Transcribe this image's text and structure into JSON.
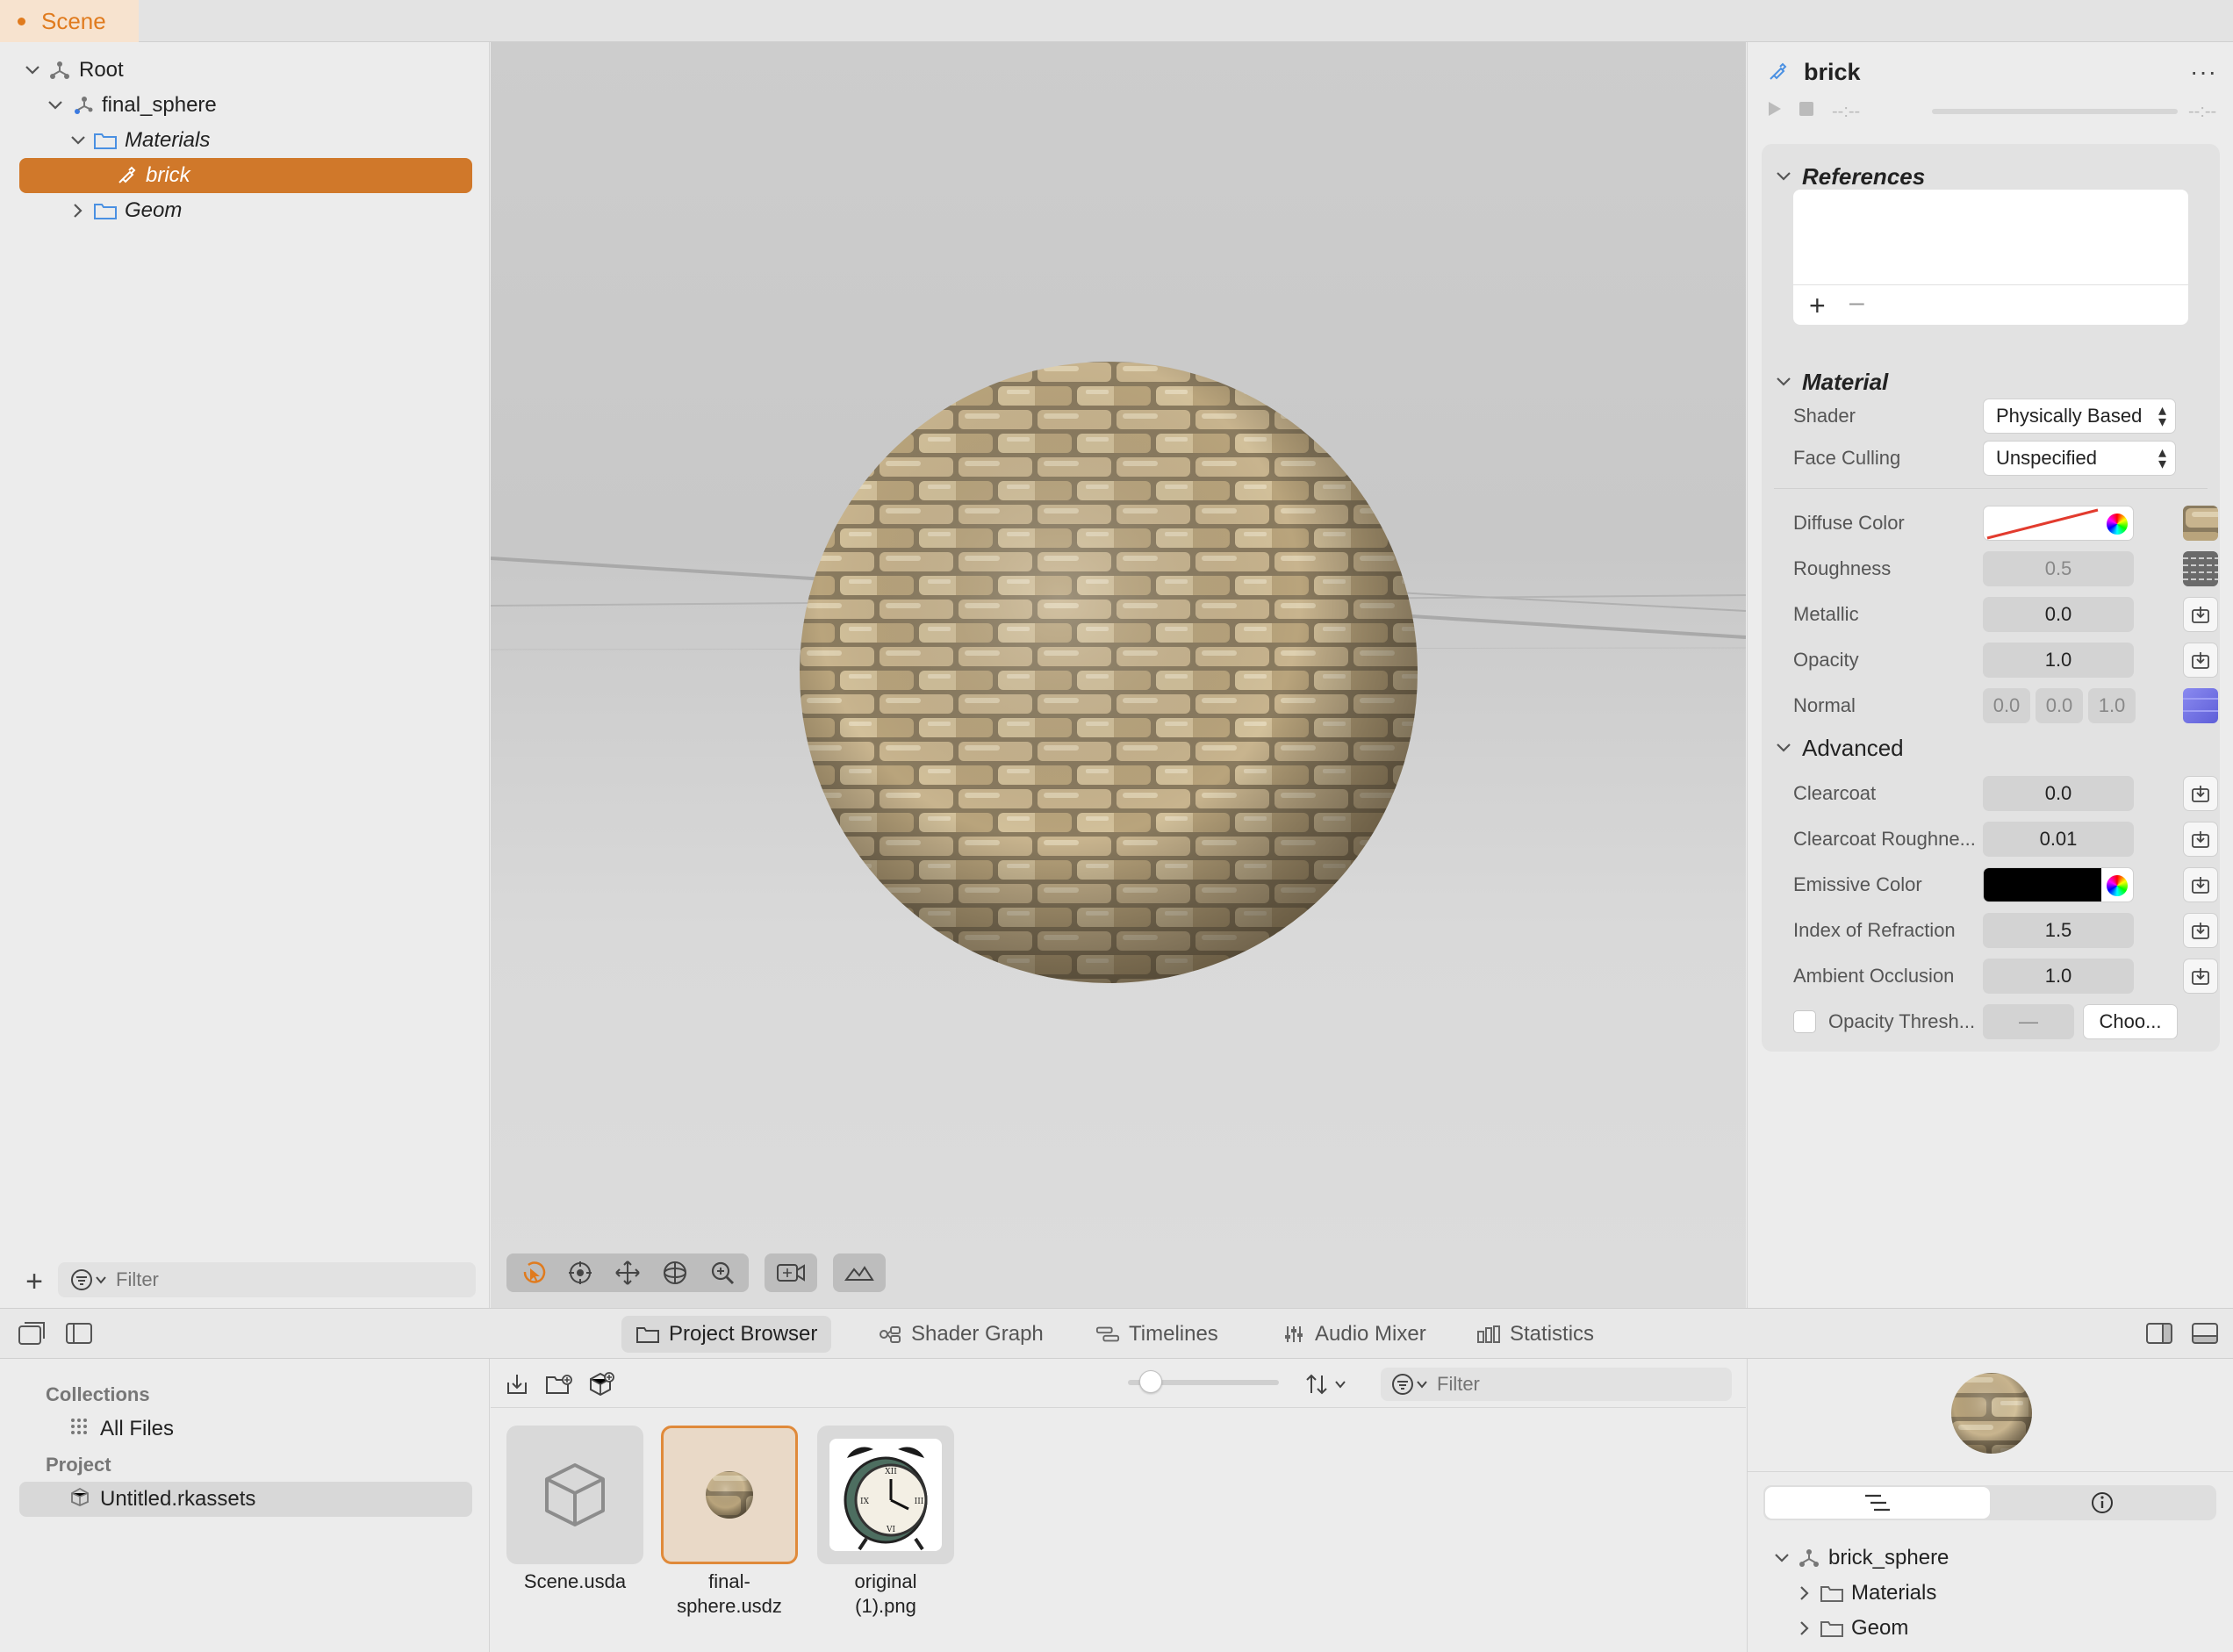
{
  "tabs": {
    "scene": "Scene"
  },
  "outline": {
    "items": [
      {
        "label": "Root"
      },
      {
        "label": "final_sphere"
      },
      {
        "label": "Materials"
      },
      {
        "label": "brick"
      },
      {
        "label": "Geom"
      }
    ],
    "filter_placeholder": "Filter"
  },
  "inspector": {
    "title": "brick",
    "playback": {
      "time_start": "--:--",
      "time_end": "--:--"
    },
    "references": {
      "header": "References"
    },
    "material": {
      "header": "Material",
      "shader_label": "Shader",
      "shader_value": "Physically Based",
      "face_culling_label": "Face Culling",
      "face_culling_value": "Unspecified",
      "diffuse_label": "Diffuse Color",
      "roughness_label": "Roughness",
      "roughness_value": "0.5",
      "metallic_label": "Metallic",
      "metallic_value": "0.0",
      "opacity_label": "Opacity",
      "opacity_value": "1.0",
      "normal_label": "Normal",
      "normal_x": "0.0",
      "normal_y": "0.0",
      "normal_z": "1.0"
    },
    "advanced": {
      "header": "Advanced",
      "clearcoat_label": "Clearcoat",
      "clearcoat_value": "0.0",
      "clearcoat_rough_label": "Clearcoat Roughne...",
      "clearcoat_rough_value": "0.01",
      "emissive_label": "Emissive Color",
      "ior_label": "Index of Refraction",
      "ior_value": "1.5",
      "ao_label": "Ambient Occlusion",
      "ao_value": "1.0",
      "opacity_thresh_label": "Opacity Thresh...",
      "opacity_thresh_value": "—",
      "choose_label": "Choo..."
    }
  },
  "bottom_tabs": [
    {
      "label": "Project Browser",
      "active": true
    },
    {
      "label": "Shader Graph"
    },
    {
      "label": "Timelines"
    },
    {
      "label": "Audio Mixer"
    },
    {
      "label": "Statistics"
    }
  ],
  "collections": {
    "collections_header": "Collections",
    "all_files": "All Files",
    "project_header": "Project",
    "project_item": "Untitled.rkassets"
  },
  "browser": {
    "filter_placeholder": "Filter",
    "zoom_level": 0.15,
    "assets": [
      {
        "label": "Scene.usda"
      },
      {
        "label": "final-sphere.usdz",
        "line1": "final-",
        "line2": "sphere.usdz"
      },
      {
        "label": "original (1).png",
        "line1": "original",
        "line2": "(1).png"
      }
    ]
  },
  "preview": {
    "tree": [
      {
        "label": "brick_sphere"
      },
      {
        "label": "Materials"
      },
      {
        "label": "Geom"
      }
    ]
  },
  "colors": {
    "accent": "#e07b1e",
    "selection": "#d0782a"
  }
}
